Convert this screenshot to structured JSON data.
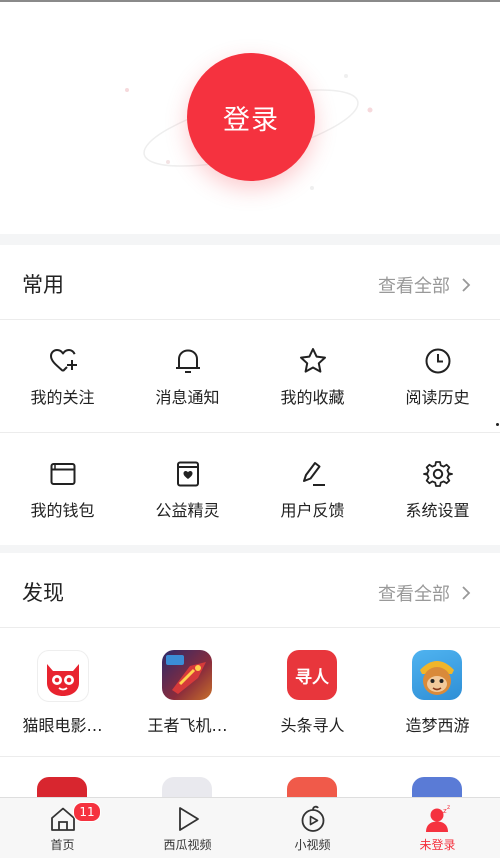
{
  "login": {
    "label": "登录"
  },
  "common": {
    "title": "常用",
    "more": "查看全部",
    "rows": [
      [
        {
          "icon": "heart-plus-icon",
          "label": "我的关注"
        },
        {
          "icon": "bell-icon",
          "label": "消息通知"
        },
        {
          "icon": "star-icon",
          "label": "我的收藏"
        },
        {
          "icon": "clock-icon",
          "label": "阅读历史"
        }
      ],
      [
        {
          "icon": "wallet-icon",
          "label": "我的钱包"
        },
        {
          "icon": "charity-box-icon",
          "label": "公益精灵"
        },
        {
          "icon": "edit-icon",
          "label": "用户反馈"
        },
        {
          "icon": "gear-icon",
          "label": "系统设置"
        }
      ]
    ]
  },
  "discover": {
    "title": "发现",
    "more": "查看全部",
    "apps": [
      {
        "icon": "maoyan-cat-icon",
        "label": "猫眼电影…",
        "color": "#e8232f"
      },
      {
        "icon": "fighter-game-icon",
        "label": "王者飞机…",
        "color": "#3a3576"
      },
      {
        "icon": "xunren-icon",
        "label": "头条寻人",
        "color": "#e8363c",
        "text": "寻人"
      },
      {
        "icon": "monkey-game-icon",
        "label": "造梦西游",
        "color": "#2f8fd6"
      }
    ]
  },
  "tabbar": {
    "tabs": [
      {
        "icon": "home-icon",
        "label": "首页",
        "badge": "11"
      },
      {
        "icon": "play-icon",
        "label": "西瓜视频"
      },
      {
        "icon": "small-video-icon",
        "label": "小视频"
      },
      {
        "icon": "user-icon",
        "label": "未登录"
      }
    ],
    "active_color": "#f5323f"
  }
}
